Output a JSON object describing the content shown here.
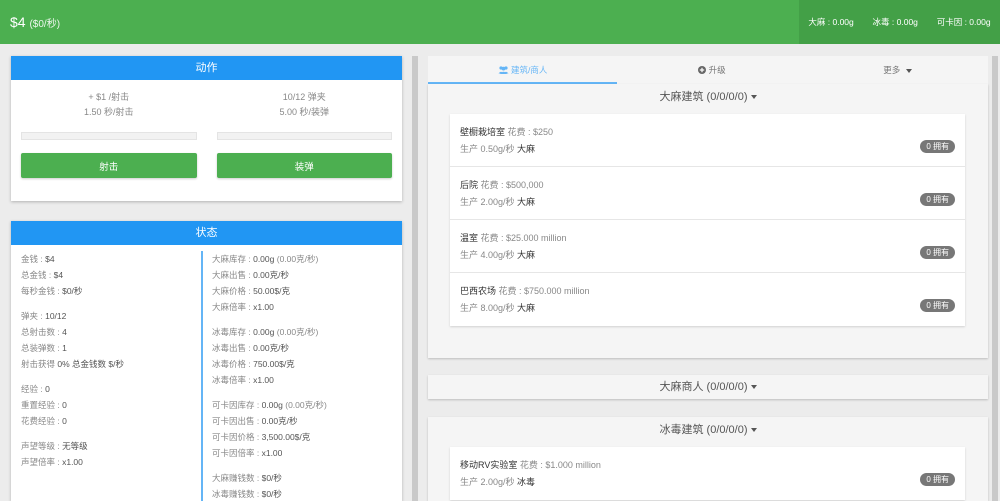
{
  "header": {
    "money": "$4",
    "money_rate": "($0/秒)",
    "stock": [
      {
        "label": "大麻 : 0.00g"
      },
      {
        "label": "冰毒 : 0.00g"
      },
      {
        "label": "可卡因 : 0.00g"
      }
    ]
  },
  "actions": {
    "title": "动作",
    "shoot": {
      "line1": "+ $1 /射击",
      "line2": "1.50 秒/射击",
      "progress": 0,
      "button": "射击"
    },
    "reload": {
      "line1": "10/12 弹夹",
      "line2": "5.00 秒/装弹",
      "progress": 0,
      "button": "装弹"
    }
  },
  "status": {
    "title": "状态",
    "left": {
      "g1": [
        {
          "k": "金钱 : ",
          "v": "$4"
        },
        {
          "k": "总金钱 : ",
          "v": "$4"
        },
        {
          "k": "每秒金钱 : ",
          "v": "$0/秒"
        }
      ],
      "g2": [
        {
          "k": "弹夹 : ",
          "v": "10/12"
        },
        {
          "k": "总射击数 : ",
          "v": "4"
        },
        {
          "k": "总装弹数 : ",
          "v": "1"
        },
        {
          "k": "射击获得 ",
          "v": "0% 总金钱数 $/秒"
        }
      ],
      "g3": [
        {
          "k": "经验 : ",
          "v": "0"
        },
        {
          "k": "重置经验 : ",
          "v": "0"
        },
        {
          "k": "花费经验 : ",
          "v": "0"
        }
      ],
      "g4": [
        {
          "k": "声望等级 : ",
          "v": "无等级"
        },
        {
          "k": "声望倍率 : ",
          "v": "x1.00"
        }
      ]
    },
    "right": {
      "weed": [
        {
          "k": "大麻库存 : ",
          "v": "0.00g",
          "g": " (0.00克/秒)"
        },
        {
          "k": "大麻出售 : ",
          "v": "0.00克/秒",
          "g": ""
        },
        {
          "k": "大麻价格 : ",
          "v": "50.00$/克",
          "g": ""
        },
        {
          "k": "大麻倍率 : ",
          "v": "x1.00",
          "g": ""
        }
      ],
      "meth": [
        {
          "k": "冰毒库存 : ",
          "v": "0.00g",
          "g": " (0.00克/秒)"
        },
        {
          "k": "冰毒出售 : ",
          "v": "0.00克/秒",
          "g": ""
        },
        {
          "k": "冰毒价格 : ",
          "v": "750.00$/克",
          "g": ""
        },
        {
          "k": "冰毒倍率 : ",
          "v": "x1.00",
          "g": ""
        }
      ],
      "cocaine": [
        {
          "k": "可卡因库存 : ",
          "v": "0.00g",
          "g": " (0.00克/秒)"
        },
        {
          "k": "可卡因出售 : ",
          "v": "0.00克/秒",
          "g": ""
        },
        {
          "k": "可卡因价格 : ",
          "v": "3,500.00$/克",
          "g": ""
        },
        {
          "k": "可卡因倍率 : ",
          "v": "x1.00",
          "g": ""
        }
      ],
      "earn": [
        {
          "k": "大麻赚钱数 : ",
          "v": "$0/秒",
          "g": ""
        },
        {
          "k": "冰毒赚钱数 : ",
          "v": "$0/秒",
          "g": ""
        }
      ]
    }
  },
  "tabs": [
    {
      "label": "建筑/商人",
      "icon": "users-icon"
    },
    {
      "label": "升级",
      "icon": "plus-circle-icon"
    },
    {
      "label": "更多",
      "icon": "caret-down-icon"
    }
  ],
  "weed_buildings": {
    "title": "大麻建筑 (0/0/0/0)",
    "items": [
      {
        "name": "壁橱栽培室",
        "cost": " 花费 : $250",
        "prod_prefix": "生产 0.50g/秒 ",
        "prod_type": "大麻",
        "owned": "0 拥有"
      },
      {
        "name": "后院",
        "cost": " 花费 : $500,000",
        "prod_prefix": "生产 2.00g/秒 ",
        "prod_type": "大麻",
        "owned": "0 拥有"
      },
      {
        "name": "温室",
        "cost": " 花费 : $25.000 million",
        "prod_prefix": "生产 4.00g/秒 ",
        "prod_type": "大麻",
        "owned": "0 拥有"
      },
      {
        "name": "巴西农场",
        "cost": " 花费 : $750.000 million",
        "prod_prefix": "生产 8.00g/秒 ",
        "prod_type": "大麻",
        "owned": "0 拥有"
      }
    ]
  },
  "weed_dealers": {
    "title": "大麻商人 (0/0/0/0)"
  },
  "meth_buildings": {
    "title": "冰毒建筑 (0/0/0/0)",
    "items": [
      {
        "name": "移动RV实验室",
        "cost": " 花费 : $1.000 million",
        "prod_prefix": "生产 2.00g/秒 ",
        "prod_type": "冰毒",
        "owned": "0 拥有"
      }
    ]
  }
}
